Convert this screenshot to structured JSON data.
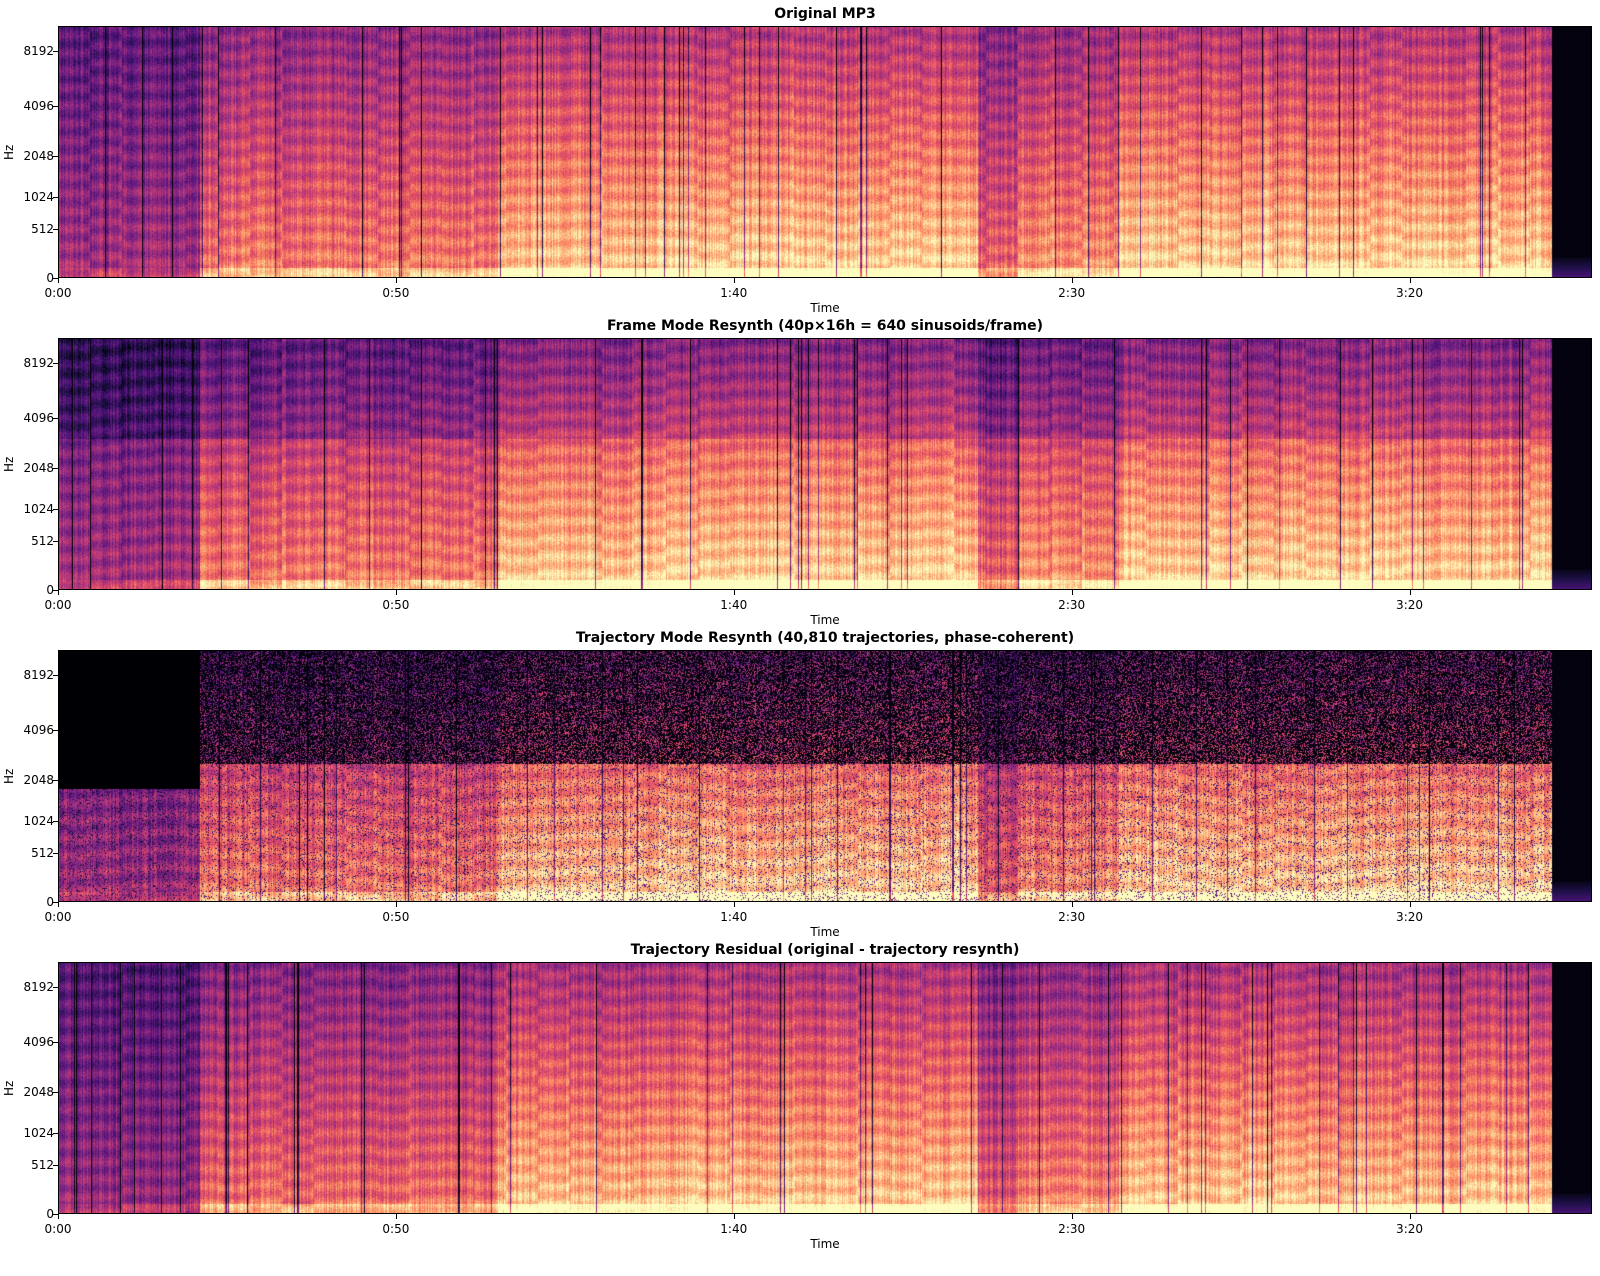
{
  "chart_data": [
    {
      "type": "heatmap",
      "title": "Original MP3",
      "xlabel": "Time",
      "ylabel": "Hz",
      "x_tick_labels": [
        "0:00",
        "0:50",
        "1:40",
        "2:30",
        "3:20"
      ],
      "x_tick_seconds": [
        0,
        50,
        100,
        150,
        200
      ],
      "xlim_seconds": [
        0,
        227
      ],
      "y_tick_labels": [
        "0",
        "512",
        "1024",
        "2048",
        "4096",
        "8192"
      ],
      "y_tick_hz": [
        0,
        512,
        1024,
        2048,
        4096,
        8192
      ],
      "ylim_hz": [
        0,
        11025
      ],
      "y_scale": "mel",
      "colormap": "magma",
      "variant": "original"
    },
    {
      "type": "heatmap",
      "title": "Frame Mode Resynth (40p×16h = 640 sinusoids/frame)",
      "xlabel": "Time",
      "ylabel": "Hz",
      "x_tick_labels": [
        "0:00",
        "0:50",
        "1:40",
        "2:30",
        "3:20"
      ],
      "x_tick_seconds": [
        0,
        50,
        100,
        150,
        200
      ],
      "xlim_seconds": [
        0,
        227
      ],
      "y_tick_labels": [
        "0",
        "512",
        "1024",
        "2048",
        "4096",
        "8192"
      ],
      "y_tick_hz": [
        0,
        512,
        1024,
        2048,
        4096,
        8192
      ],
      "ylim_hz": [
        0,
        11025
      ],
      "y_scale": "mel",
      "colormap": "magma",
      "variant": "frame"
    },
    {
      "type": "heatmap",
      "title": "Trajectory Mode Resynth (40,810 trajectories, phase-coherent)",
      "xlabel": "Time",
      "ylabel": "Hz",
      "x_tick_labels": [
        "0:00",
        "0:50",
        "1:40",
        "2:30",
        "3:20"
      ],
      "x_tick_seconds": [
        0,
        50,
        100,
        150,
        200
      ],
      "xlim_seconds": [
        0,
        227
      ],
      "y_tick_labels": [
        "0",
        "512",
        "1024",
        "2048",
        "4096",
        "8192"
      ],
      "y_tick_hz": [
        0,
        512,
        1024,
        2048,
        4096,
        8192
      ],
      "ylim_hz": [
        0,
        11025
      ],
      "y_scale": "mel",
      "colormap": "magma",
      "variant": "trajectory"
    },
    {
      "type": "heatmap",
      "title": "Trajectory Residual (original - trajectory resynth)",
      "xlabel": "Time",
      "ylabel": "Hz",
      "x_tick_labels": [
        "0:00",
        "0:50",
        "1:40",
        "2:30",
        "3:20"
      ],
      "x_tick_seconds": [
        0,
        50,
        100,
        150,
        200
      ],
      "xlim_seconds": [
        0,
        227
      ],
      "y_tick_labels": [
        "0",
        "512",
        "1024",
        "2048",
        "4096",
        "8192"
      ],
      "y_tick_hz": [
        0,
        512,
        1024,
        2048,
        4096,
        8192
      ],
      "ylim_hz": [
        0,
        11025
      ],
      "y_scale": "mel",
      "colormap": "magma",
      "variant": "residual"
    }
  ],
  "colors": {
    "background": "#ffffff",
    "axis": "#000000",
    "text": "#000000"
  }
}
